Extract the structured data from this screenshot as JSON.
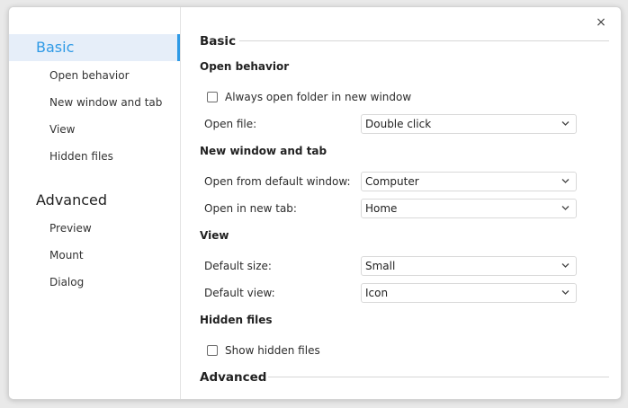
{
  "dialog": {
    "close_label": "×"
  },
  "sidebar": {
    "groups": [
      {
        "label": "Basic",
        "items": [
          "Open behavior",
          "New window and tab",
          "View",
          "Hidden files"
        ]
      },
      {
        "label": "Advanced",
        "items": [
          "Preview",
          "Mount",
          "Dialog"
        ]
      }
    ],
    "active_group": "Basic"
  },
  "content": {
    "basic_title": "Basic",
    "advanced_title": "Advanced",
    "open_behavior": {
      "title": "Open behavior",
      "always_open_folder_label": "Always open folder in new window",
      "always_open_folder_checked": false,
      "open_file_label": "Open file:",
      "open_file_value": "Double click"
    },
    "new_window_tab": {
      "title": "New window and tab",
      "default_window_label": "Open from default window:",
      "default_window_value": "Computer",
      "new_tab_label": "Open in new tab:",
      "new_tab_value": "Home"
    },
    "view": {
      "title": "View",
      "default_size_label": "Default size:",
      "default_size_value": "Small",
      "default_view_label": "Default view:",
      "default_view_value": "Icon"
    },
    "hidden_files": {
      "title": "Hidden files",
      "show_hidden_label": "Show hidden files",
      "show_hidden_checked": false
    }
  },
  "colors": {
    "accent": "#2f9ae6",
    "active_bg": "#e6eef9"
  }
}
